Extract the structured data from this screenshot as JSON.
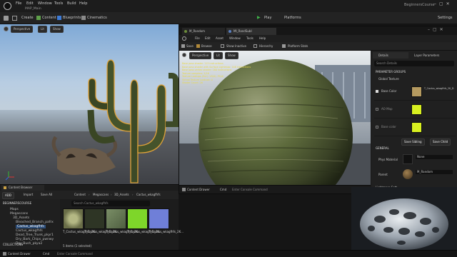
{
  "app": {
    "menu": [
      "File",
      "Edit",
      "Window",
      "Tools",
      "Build",
      "Help"
    ],
    "map_tab": "MAP_Main",
    "project_name": "BeginnersCourse",
    "toolbar": {
      "create": "Create",
      "content": "Content",
      "blueprints": "Blueprints",
      "cinematics": "Cinematics",
      "play": "Play",
      "platforms": "Platforms",
      "settings": "Settings"
    }
  },
  "viewport": {
    "buttons": [
      "Perspective",
      "Lit",
      "Show"
    ]
  },
  "material_editor": {
    "tabs": [
      "M_Random",
      "MI_RandSubI"
    ],
    "menu": [
      "File",
      "Edit",
      "Asset",
      "Window",
      "Tools",
      "Help"
    ],
    "toolbar": [
      "Save",
      "Browse",
      "Show Inactive",
      "Hierarchy",
      "Platform Stats"
    ],
    "viewport_buttons": [
      "Perspective",
      "Lit",
      "Show"
    ],
    "stats": [
      "Base pass shader: 113 instructions",
      "Base pass shader with Surface Lightmap: 146 instructions",
      "Base pass vertex shader: 160 instructions",
      "Texture samplers: 5/16",
      "Texture Lookups (Est.): VS(0), PS(4)",
      "Virtual Texture Lookups: 0",
      "Shader Count: 26"
    ],
    "bottom": {
      "content_drawer": "Content Drawer",
      "cmd": "Cmd",
      "console_placeholder": "Enter Console Command"
    }
  },
  "details": {
    "tabs": [
      "Details",
      "Layer Parameters"
    ],
    "search_placeholder": "Search Details",
    "sections": {
      "parameter_groups": "PARAMETER GROUPS",
      "global_texture": "Global Texture",
      "general": "GENERAL",
      "lightmass": "Lightmass Sett"
    },
    "params": [
      {
        "label": "Base Color",
        "value": "T_Cactus_wkagfhfs_2K_D",
        "color": "#b59a60"
      },
      {
        "label": "AO Map",
        "value": "",
        "color": "#d8f020"
      },
      {
        "label": "Base color",
        "value": "",
        "color": "#d8f020"
      }
    ],
    "buttons": {
      "save_sibling": "Save Sibling",
      "save_child": "Save Child"
    },
    "phys_material_label": "Phys Material",
    "phys_material_value": "None",
    "parent_label": "Parent",
    "parent_value": "M_Random"
  },
  "content_browser": {
    "tab": "Content Browser",
    "add": "ADD",
    "import": "Import",
    "save_all": "Save All",
    "breadcrumb": [
      "Content",
      "Megascans",
      "3D_Assets",
      "Cactus_wkagfhfs"
    ],
    "search_placeholder": "Search Cactus_wkagfhfs",
    "project_label": "BEGINNERSCOURSE",
    "tree": [
      "Maps",
      "Megascans",
      "3D_Assets",
      "Bleached_Branch_pafrx",
      "Cactus_wkagfhfs",
      "Cactus_wkagfhfs",
      "Dead_Tree_Trunk_pkyr1",
      "Dry_Bark_Chips_pwnwy",
      "Dry_Bush_pkya2"
    ],
    "assets": [
      {
        "name": "T_Cactus_wkagfhfs_2K...",
        "color": "#9aa06a"
      },
      {
        "name": "T_Cactus_wkagfhfs_2K...",
        "color": "#2e3525"
      },
      {
        "name": "T_Cactus_wkagfhfs_2K...",
        "color": "#6a7c5a"
      },
      {
        "name": "T_Cactus_wkagfhfs_2K...",
        "color": "#7ed62a"
      },
      {
        "name": "T_Cactus_wkagfhfs_2K...",
        "color": "#6f7fd8"
      }
    ],
    "status": "5 items (1 selected)",
    "collections": "COLLECTIONS"
  },
  "bottom_bar": {
    "content_drawer": "Content Drawer",
    "cmd": "Cmd",
    "console_placeholder": "Enter Console Command"
  }
}
